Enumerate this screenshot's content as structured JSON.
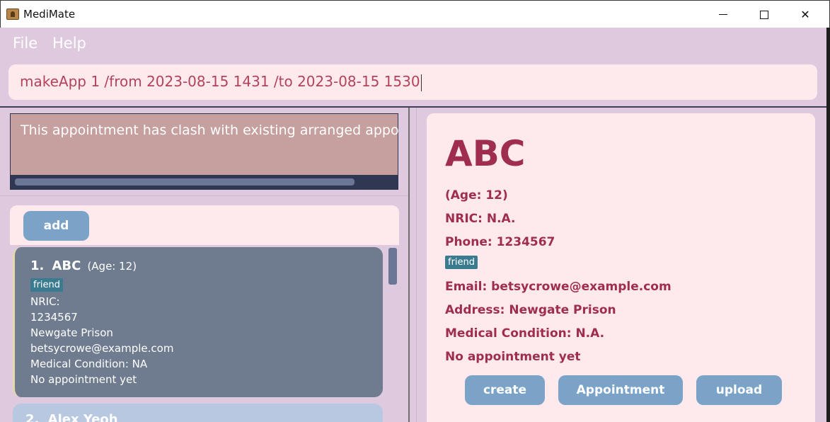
{
  "window": {
    "title": "MediMate",
    "minimize": "—",
    "maximize": "☐",
    "close": "✕"
  },
  "menu": {
    "file": "File",
    "help": "Help"
  },
  "command": {
    "value": "makeApp 1 /from 2023-08-15 1431 /to 2023-08-15 1530"
  },
  "result": {
    "message": "This appointment has clash with existing arranged appointment"
  },
  "list": {
    "add_label": "add",
    "cards": [
      {
        "index": "1.",
        "name": "ABC",
        "age": "(Age: 12)",
        "tag": "friend",
        "nric": "NRIC:",
        "phone": "1234567",
        "address": "Newgate Prison",
        "email": "betsycrowe@example.com",
        "medical": "Medical Condition: NA",
        "appointment": "No appointment yet"
      },
      {
        "index": "2.",
        "name": "Alex Yeoh"
      }
    ]
  },
  "detail": {
    "name": "ABC",
    "age": "(Age: 12)",
    "nric": "NRIC: N.A.",
    "phone": "Phone: 1234567",
    "tag": "friend",
    "email": "Email: betsycrowe@example.com",
    "address": "Address: Newgate Prison",
    "medical": "Medical Condition: N.A.",
    "appointment": "No appointment yet",
    "buttons": {
      "create": "create",
      "appointment": "Appointment",
      "upload": "upload"
    }
  }
}
